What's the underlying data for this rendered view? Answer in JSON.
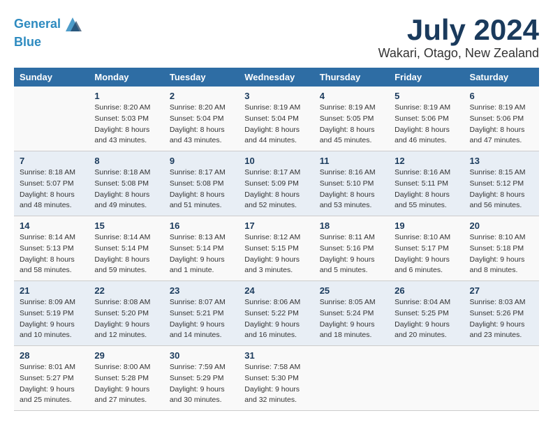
{
  "header": {
    "logo_line1": "General",
    "logo_line2": "Blue",
    "month_title": "July 2024",
    "location": "Wakari, Otago, New Zealand"
  },
  "calendar": {
    "days_of_week": [
      "Sunday",
      "Monday",
      "Tuesday",
      "Wednesday",
      "Thursday",
      "Friday",
      "Saturday"
    ],
    "rows": [
      [
        {
          "day": "",
          "info": ""
        },
        {
          "day": "1",
          "info": "Sunrise: 8:20 AM\nSunset: 5:03 PM\nDaylight: 8 hours\nand 43 minutes."
        },
        {
          "day": "2",
          "info": "Sunrise: 8:20 AM\nSunset: 5:04 PM\nDaylight: 8 hours\nand 43 minutes."
        },
        {
          "day": "3",
          "info": "Sunrise: 8:19 AM\nSunset: 5:04 PM\nDaylight: 8 hours\nand 44 minutes."
        },
        {
          "day": "4",
          "info": "Sunrise: 8:19 AM\nSunset: 5:05 PM\nDaylight: 8 hours\nand 45 minutes."
        },
        {
          "day": "5",
          "info": "Sunrise: 8:19 AM\nSunset: 5:06 PM\nDaylight: 8 hours\nand 46 minutes."
        },
        {
          "day": "6",
          "info": "Sunrise: 8:19 AM\nSunset: 5:06 PM\nDaylight: 8 hours\nand 47 minutes."
        }
      ],
      [
        {
          "day": "7",
          "info": "Sunrise: 8:18 AM\nSunset: 5:07 PM\nDaylight: 8 hours\nand 48 minutes."
        },
        {
          "day": "8",
          "info": "Sunrise: 8:18 AM\nSunset: 5:08 PM\nDaylight: 8 hours\nand 49 minutes."
        },
        {
          "day": "9",
          "info": "Sunrise: 8:17 AM\nSunset: 5:08 PM\nDaylight: 8 hours\nand 51 minutes."
        },
        {
          "day": "10",
          "info": "Sunrise: 8:17 AM\nSunset: 5:09 PM\nDaylight: 8 hours\nand 52 minutes."
        },
        {
          "day": "11",
          "info": "Sunrise: 8:16 AM\nSunset: 5:10 PM\nDaylight: 8 hours\nand 53 minutes."
        },
        {
          "day": "12",
          "info": "Sunrise: 8:16 AM\nSunset: 5:11 PM\nDaylight: 8 hours\nand 55 minutes."
        },
        {
          "day": "13",
          "info": "Sunrise: 8:15 AM\nSunset: 5:12 PM\nDaylight: 8 hours\nand 56 minutes."
        }
      ],
      [
        {
          "day": "14",
          "info": "Sunrise: 8:14 AM\nSunset: 5:13 PM\nDaylight: 8 hours\nand 58 minutes."
        },
        {
          "day": "15",
          "info": "Sunrise: 8:14 AM\nSunset: 5:14 PM\nDaylight: 8 hours\nand 59 minutes."
        },
        {
          "day": "16",
          "info": "Sunrise: 8:13 AM\nSunset: 5:14 PM\nDaylight: 9 hours\nand 1 minute."
        },
        {
          "day": "17",
          "info": "Sunrise: 8:12 AM\nSunset: 5:15 PM\nDaylight: 9 hours\nand 3 minutes."
        },
        {
          "day": "18",
          "info": "Sunrise: 8:11 AM\nSunset: 5:16 PM\nDaylight: 9 hours\nand 5 minutes."
        },
        {
          "day": "19",
          "info": "Sunrise: 8:10 AM\nSunset: 5:17 PM\nDaylight: 9 hours\nand 6 minutes."
        },
        {
          "day": "20",
          "info": "Sunrise: 8:10 AM\nSunset: 5:18 PM\nDaylight: 9 hours\nand 8 minutes."
        }
      ],
      [
        {
          "day": "21",
          "info": "Sunrise: 8:09 AM\nSunset: 5:19 PM\nDaylight: 9 hours\nand 10 minutes."
        },
        {
          "day": "22",
          "info": "Sunrise: 8:08 AM\nSunset: 5:20 PM\nDaylight: 9 hours\nand 12 minutes."
        },
        {
          "day": "23",
          "info": "Sunrise: 8:07 AM\nSunset: 5:21 PM\nDaylight: 9 hours\nand 14 minutes."
        },
        {
          "day": "24",
          "info": "Sunrise: 8:06 AM\nSunset: 5:22 PM\nDaylight: 9 hours\nand 16 minutes."
        },
        {
          "day": "25",
          "info": "Sunrise: 8:05 AM\nSunset: 5:24 PM\nDaylight: 9 hours\nand 18 minutes."
        },
        {
          "day": "26",
          "info": "Sunrise: 8:04 AM\nSunset: 5:25 PM\nDaylight: 9 hours\nand 20 minutes."
        },
        {
          "day": "27",
          "info": "Sunrise: 8:03 AM\nSunset: 5:26 PM\nDaylight: 9 hours\nand 23 minutes."
        }
      ],
      [
        {
          "day": "28",
          "info": "Sunrise: 8:01 AM\nSunset: 5:27 PM\nDaylight: 9 hours\nand 25 minutes."
        },
        {
          "day": "29",
          "info": "Sunrise: 8:00 AM\nSunset: 5:28 PM\nDaylight: 9 hours\nand 27 minutes."
        },
        {
          "day": "30",
          "info": "Sunrise: 7:59 AM\nSunset: 5:29 PM\nDaylight: 9 hours\nand 30 minutes."
        },
        {
          "day": "31",
          "info": "Sunrise: 7:58 AM\nSunset: 5:30 PM\nDaylight: 9 hours\nand 32 minutes."
        },
        {
          "day": "",
          "info": ""
        },
        {
          "day": "",
          "info": ""
        },
        {
          "day": "",
          "info": ""
        }
      ]
    ]
  }
}
